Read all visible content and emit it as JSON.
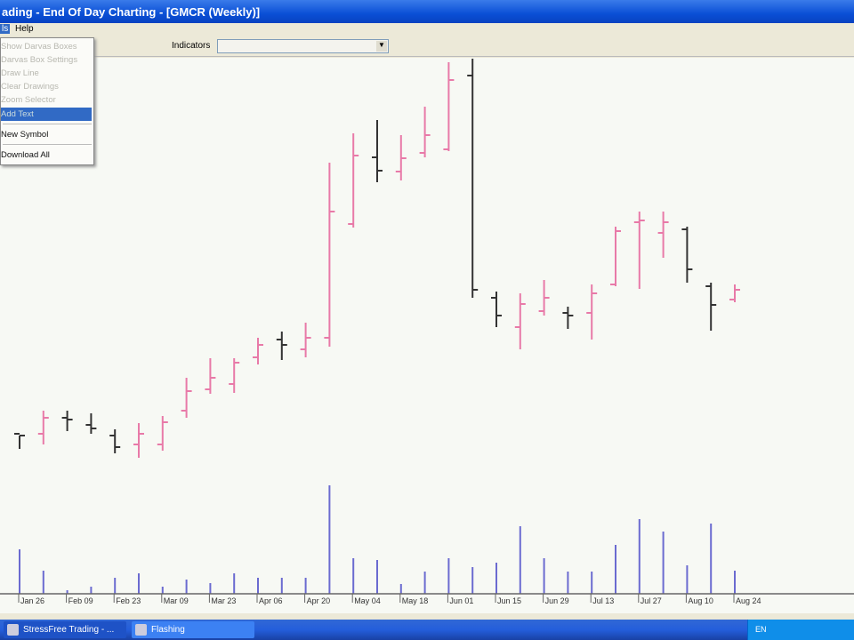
{
  "window": {
    "title": "ading - End Of Day Charting - [GMCR (Weekly)]"
  },
  "menu": {
    "items": [
      "ls",
      "Help"
    ]
  },
  "toolbar": {
    "indicators_label": "Indicators",
    "indicators_value": ""
  },
  "dropdown": {
    "items": [
      {
        "label": "Show Darvas Boxes",
        "enabled": false
      },
      {
        "label": "Darvas Box Settings",
        "enabled": false
      },
      {
        "label": "Draw Line",
        "enabled": false
      },
      {
        "label": "Clear Drawings",
        "enabled": false
      },
      {
        "label": "Zoom Selector",
        "enabled": false
      },
      {
        "label": "Add Text",
        "enabled": true,
        "selected": true
      },
      {
        "label": "New Symbol",
        "enabled": true
      },
      {
        "label": "Download All",
        "enabled": true
      }
    ]
  },
  "colors": {
    "up": "#e87aa8",
    "down": "#333333",
    "volume": "#6b6bd0"
  },
  "chart_data": {
    "type": "ohlc",
    "symbol": "GMCR",
    "period": "Weekly",
    "x_labels": [
      "Jan 26",
      "Feb 09",
      "Feb 23",
      "Mar 09",
      "Mar 23",
      "Apr 06",
      "Apr 20",
      "May 04",
      "May 18",
      "Jun 01",
      "Jun 15",
      "Jun 29",
      "Jul 13",
      "Jul 27",
      "Aug 10",
      "Aug 24"
    ],
    "bars": [
      [
        21.2,
        21,
        19.5,
        21.0,
        "d"
      ],
      [
        21.2,
        23.8,
        20.0,
        23.0,
        "u"
      ],
      [
        23.0,
        23.8,
        21.5,
        22.8,
        "d"
      ],
      [
        22.2,
        23.5,
        21.2,
        21.8,
        "d"
      ],
      [
        21.0,
        21.7,
        19.0,
        19.7,
        "d"
      ],
      [
        20.0,
        22.4,
        18.5,
        21.2,
        "u"
      ],
      [
        20.0,
        23.2,
        19.3,
        22.5,
        "u"
      ],
      [
        23.8,
        27.5,
        23.0,
        26.0,
        "u"
      ],
      [
        26.2,
        29.7,
        25.7,
        27.5,
        "u"
      ],
      [
        26.8,
        29.7,
        25.8,
        29.2,
        "u"
      ],
      [
        29.8,
        32.0,
        29.0,
        31.2,
        "u"
      ],
      [
        31.8,
        32.7,
        29.5,
        31.2,
        "d"
      ],
      [
        30.7,
        33.7,
        29.8,
        32.0,
        "u"
      ],
      [
        32.0,
        51.7,
        31.0,
        46.2,
        "u"
      ],
      [
        44.8,
        55.0,
        44.4,
        52.5,
        "u"
      ],
      [
        52.3,
        56.5,
        49.5,
        50.8,
        "d"
      ],
      [
        50.7,
        54.8,
        49.7,
        52.2,
        "u"
      ],
      [
        52.8,
        58.0,
        52.3,
        54.8,
        "u"
      ],
      [
        53.2,
        63.0,
        53.0,
        61.0,
        "u"
      ],
      [
        61.5,
        63.4,
        36.5,
        37.4,
        "d"
      ],
      [
        36.5,
        37.2,
        33.2,
        34.5,
        "d"
      ],
      [
        33.2,
        37.0,
        30.7,
        35.8,
        "u"
      ],
      [
        35.0,
        38.5,
        34.5,
        36.5,
        "u"
      ],
      [
        34.8,
        35.5,
        33.0,
        34.5,
        "d"
      ],
      [
        34.8,
        38.0,
        31.8,
        37.0,
        "u"
      ],
      [
        38.0,
        44.5,
        37.8,
        44.0,
        "u"
      ],
      [
        45.0,
        46.2,
        37.5,
        45.2,
        "u"
      ],
      [
        43.8,
        46.2,
        41.0,
        45.0,
        "u"
      ],
      [
        44.2,
        44.5,
        38.2,
        39.7,
        "d"
      ],
      [
        37.8,
        38.2,
        32.8,
        35.7,
        "d"
      ],
      [
        36.3,
        38.0,
        36.0,
        37.4,
        "u"
      ]
    ],
    "volume": [
      50,
      26,
      4,
      8,
      18,
      23,
      8,
      16,
      12,
      23,
      18,
      18,
      18,
      122,
      40,
      38,
      11,
      25,
      40,
      30,
      35,
      76,
      40,
      25,
      25,
      55,
      84,
      70,
      32,
      79,
      26
    ]
  }
}
